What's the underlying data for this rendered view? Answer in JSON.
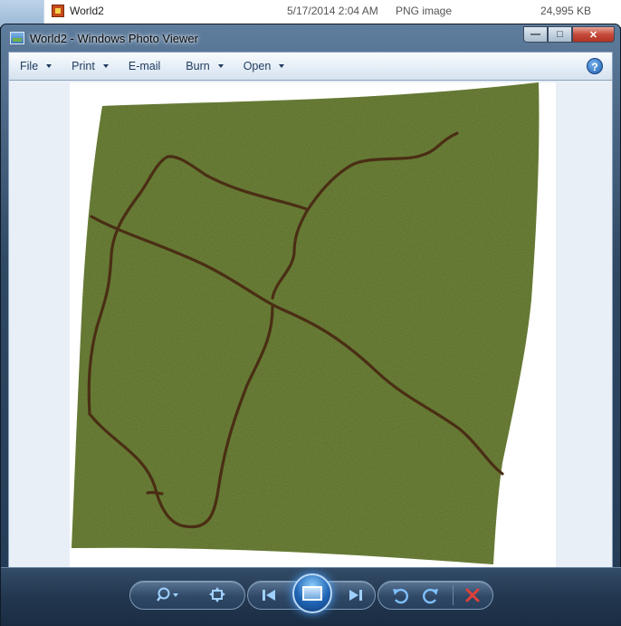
{
  "explorer": {
    "file_name": "World2",
    "file_date": "5/17/2014 2:04 AM",
    "file_type": "PNG image",
    "file_size": "24,995 KB"
  },
  "window": {
    "title": "World2 - Windows Photo Viewer",
    "caption_buttons": {
      "minimize": "minimize-icon",
      "maximize": "maximize-icon",
      "close": "close-icon"
    }
  },
  "menu": {
    "file": "File",
    "print": "Print",
    "email": "E-mail",
    "burn": "Burn",
    "open": "Open",
    "help": "?"
  },
  "image": {
    "land_color": "#556b22",
    "road_color": "#4a2e14",
    "background_color": "#ffffff"
  },
  "controls": {
    "zoom": "zoom-icon",
    "fit": "actual-size-icon",
    "previous": "previous-icon",
    "slideshow": "slideshow-icon",
    "next": "next-icon",
    "rotate_ccw": "rotate-counterclockwise-icon",
    "rotate_cw": "rotate-clockwise-icon",
    "delete": "delete-icon"
  }
}
